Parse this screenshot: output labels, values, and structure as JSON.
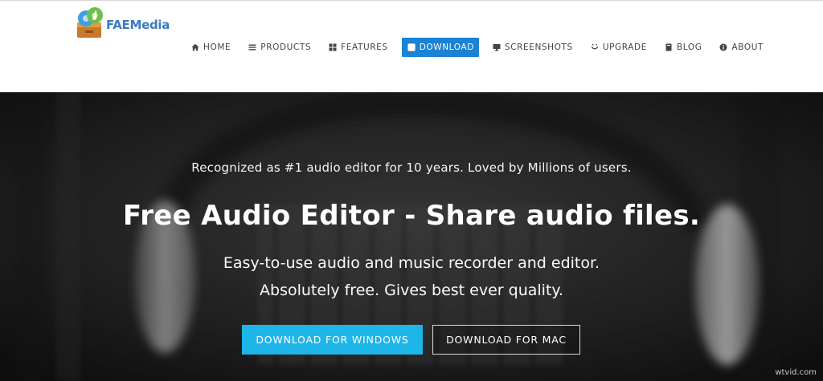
{
  "brand": {
    "name_part1": "FAE",
    "name_part2": "Media",
    "icon": "music-folder-logo-icon"
  },
  "nav": {
    "items": [
      {
        "label": "HOME",
        "icon": "home-icon"
      },
      {
        "label": "PRODUCTS",
        "icon": "list-icon"
      },
      {
        "label": "FEATURES",
        "icon": "grid-icon"
      },
      {
        "label": "DOWNLOAD",
        "icon": "download-icon",
        "active": true
      },
      {
        "label": "SCREENSHOTS",
        "icon": "monitor-icon"
      },
      {
        "label": "UPGRADE",
        "icon": "upgrade-icon"
      },
      {
        "label": "BLOG",
        "icon": "book-icon"
      },
      {
        "label": "ABOUT",
        "icon": "info-icon"
      }
    ]
  },
  "hero": {
    "tagline": "Recognized as #1 audio editor for 10 years. Loved by Millions of users.",
    "title": "Free Audio Editor - Share audio files.",
    "subtitle_line1": "Easy-to-use audio and music recorder and editor.",
    "subtitle_line2": "Absolutely free. Gives best ever quality.",
    "btn_windows": "DOWNLOAD FOR WINDOWS",
    "btn_mac": "DOWNLOAD FOR MAC"
  },
  "watermark": "wtvid.com",
  "colors": {
    "accent": "#1b82d4",
    "cta": "#1eb5e8",
    "brand_blue": "#3a7bc5"
  }
}
